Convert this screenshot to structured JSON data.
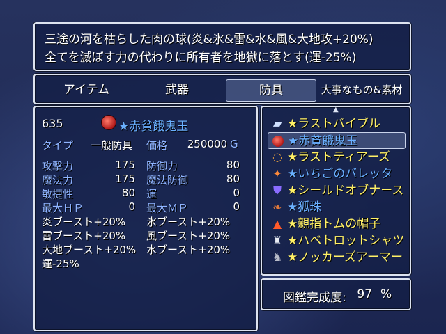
{
  "help": {
    "line1": "三途の河を枯らした肉の球(炎&氷&雷&水&風&大地攻+20%)",
    "line2": "全てを滅ぼす力の代わりに所有者を地獄に落とす(運-25%)"
  },
  "categories": [
    {
      "label": "アイテム",
      "selected": false
    },
    {
      "label": "武器",
      "selected": false
    },
    {
      "label": "防具",
      "selected": true
    },
    {
      "label": "大事なもの&素材",
      "selected": false
    }
  ],
  "status": {
    "count": "635",
    "item_name": "★赤貧餓鬼玉",
    "type_label": "タイプ",
    "type_value": "一般防具",
    "price_label": "価格",
    "price_value": "250000",
    "currency": "G",
    "stats": [
      {
        "label": "攻撃力",
        "value": "175"
      },
      {
        "label": "防御力",
        "value": "80"
      },
      {
        "label": "魔法力",
        "value": "175"
      },
      {
        "label": "魔法防御",
        "value": "80"
      },
      {
        "label": "敏捷性",
        "value": "80"
      },
      {
        "label": "運",
        "value": "0"
      },
      {
        "label": "最大ＨＰ",
        "value": "0"
      },
      {
        "label": "最大ＭＰ",
        "value": "0"
      }
    ],
    "effects": [
      "炎ブースト+20%",
      "氷ブースト+20%",
      "雷ブースト+20%",
      "風ブースト+20%",
      "大地ブースト+20%",
      "水ブースト+20%",
      "運-25%"
    ]
  },
  "list": {
    "items": [
      {
        "label": "★ラストバイブル",
        "icon": "book-icon",
        "color": "yellow",
        "selected": false
      },
      {
        "label": "★赤貧餓鬼玉",
        "icon": "red-orb-icon",
        "color": "blue",
        "selected": true
      },
      {
        "label": "★ラストティアーズ",
        "icon": "necklace-icon",
        "color": "yellow",
        "selected": false
      },
      {
        "label": "★いちごのバレッタ",
        "icon": "barrette-icon",
        "color": "blue",
        "selected": false
      },
      {
        "label": "★シールドオブナース",
        "icon": "shield-icon",
        "color": "yellow",
        "selected": false
      },
      {
        "label": "★狐珠",
        "icon": "fox-bead-icon",
        "color": "blue",
        "selected": false
      },
      {
        "label": "★親指トムの帽子",
        "icon": "hat-icon",
        "color": "yellow",
        "selected": false
      },
      {
        "label": "★ハベトロットシャツ",
        "icon": "shirt-icon",
        "color": "yellow",
        "selected": false
      },
      {
        "label": "★ノッカーズアーマー",
        "icon": "armor-icon",
        "color": "yellow",
        "selected": false
      }
    ]
  },
  "completion": {
    "label": "図鑑完成度:",
    "value": "97",
    "unit": "%"
  }
}
